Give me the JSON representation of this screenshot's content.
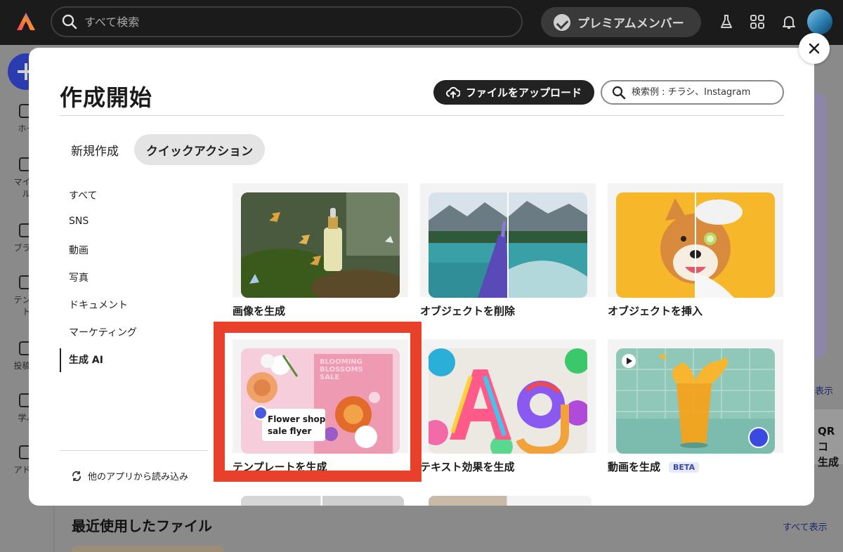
{
  "topbar": {
    "search_placeholder": "すべて検索",
    "premium_label": "プレミアムメンバー"
  },
  "rail": {
    "items": [
      "ホー",
      "マイフ\nル",
      "ブラン",
      "テンプ\nト",
      "投稿予",
      "学ぶ",
      "アドオ"
    ]
  },
  "background": {
    "right_link": "表示",
    "qr_label": "QR コ\n生成",
    "recent_title": "最近使用したファイル",
    "show_all": "すべて表示"
  },
  "modal": {
    "title": "作成開始",
    "upload_label": "ファイルをアップロード",
    "search_placeholder": "検索例 : チラシ、Instagram",
    "tabs": [
      "新規作成",
      "クイックアクション"
    ],
    "active_tab": "クイックアクション",
    "categories": [
      "すべて",
      "SNS",
      "動画",
      "写真",
      "ドキュメント",
      "マーケティング",
      "生成 AI"
    ],
    "active_category": "生成 AI",
    "import_label": "他のアプリから読み込み",
    "cards": [
      {
        "label": "画像を生成"
      },
      {
        "label": "オブジェクトを削除"
      },
      {
        "label": "オブジェクトを挿入"
      },
      {
        "label": "テンプレートを生成"
      },
      {
        "label": "テキスト効果を生成"
      },
      {
        "label": "動画を生成",
        "badge": "BETA"
      }
    ],
    "template_overlay": {
      "line1": "Flower shop",
      "line2": "sale flyer",
      "poster_text": "BLOOMING\nBLOSSOMS\nSALE"
    }
  },
  "colors": {
    "highlight": "#e8402a",
    "topbar": "#1b1b1b",
    "accent_blue": "#2b3bb0"
  }
}
